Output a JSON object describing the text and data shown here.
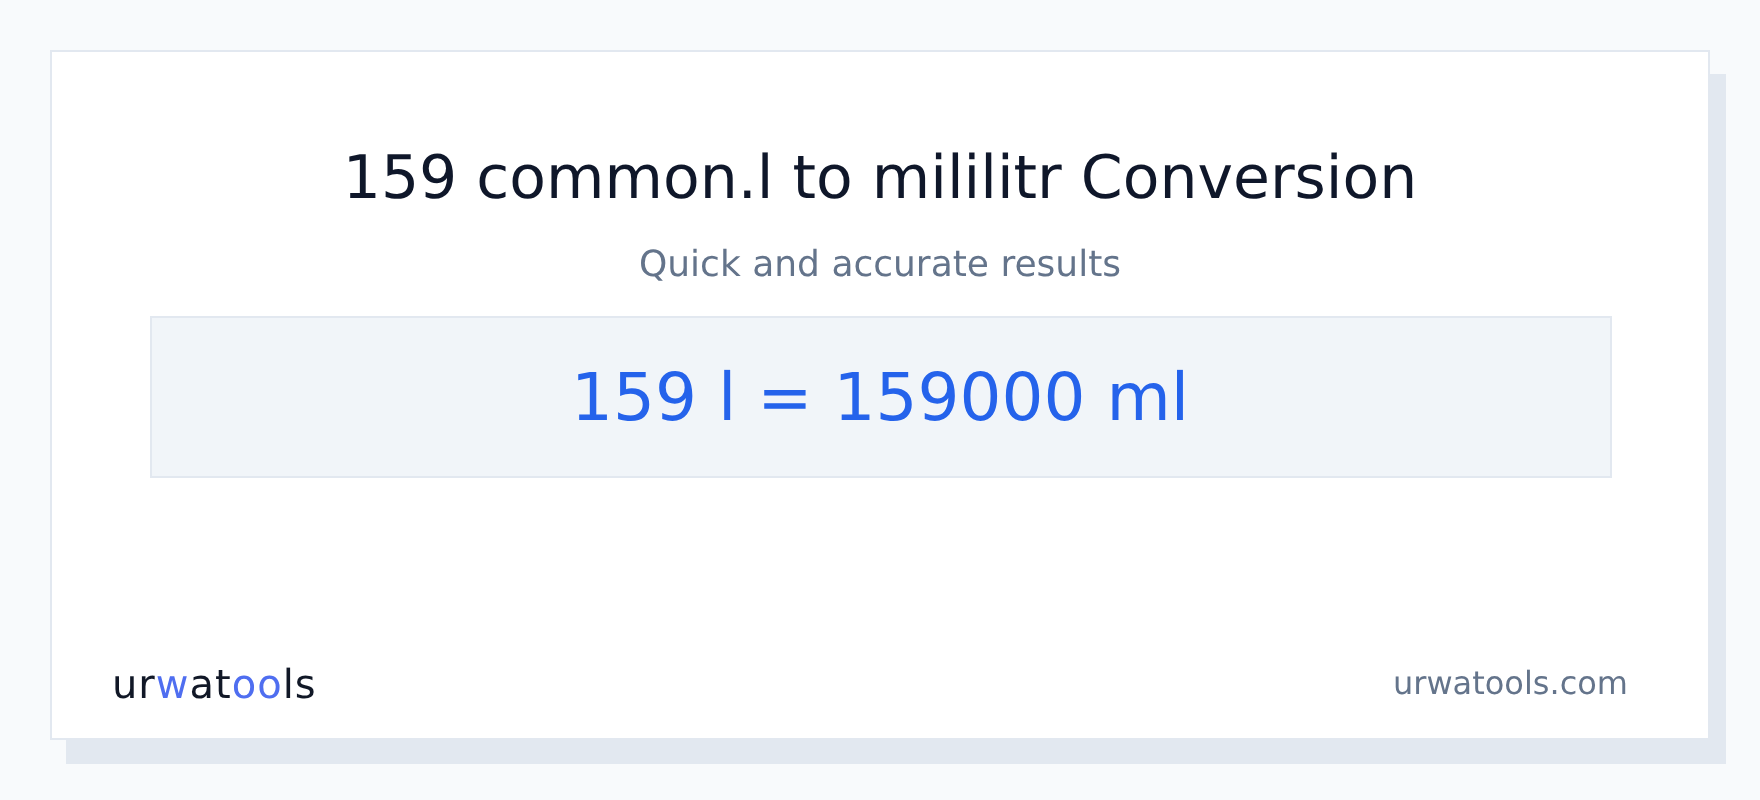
{
  "title": "159 common.l to mililitr Conversion",
  "subtitle": "Quick and accurate results",
  "result": "159 l = 159000 ml",
  "logo": [
    {
      "text": "ur",
      "accent": false
    },
    {
      "text": "w",
      "accent": true
    },
    {
      "text": "at",
      "accent": false
    },
    {
      "text": "oo",
      "accent": true
    },
    {
      "text": "ls",
      "accent": false
    }
  ],
  "site": "urwatools.com"
}
